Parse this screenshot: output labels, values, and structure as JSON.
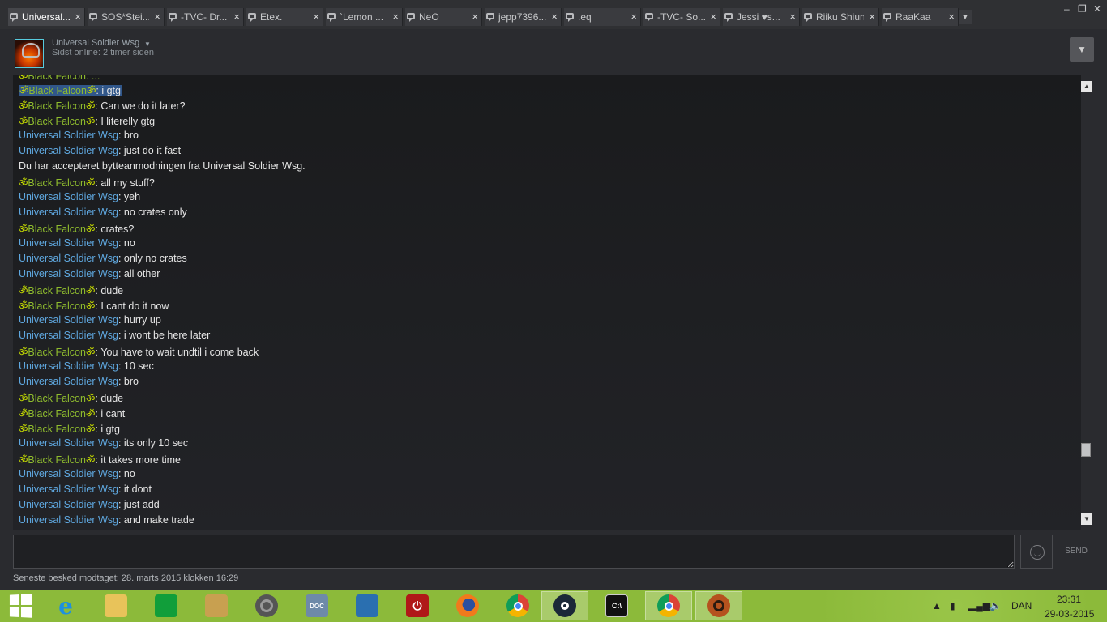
{
  "tabs": [
    {
      "label": "Universal...",
      "active": true
    },
    {
      "label": "SOS*Stei..."
    },
    {
      "label": "-TVC- Dr..."
    },
    {
      "label": "Etex."
    },
    {
      "label": "`Lemon ..."
    },
    {
      "label": "NeO"
    },
    {
      "label": "jepp7396..."
    },
    {
      "label": ".eq"
    },
    {
      "label": "-TVC- So..."
    },
    {
      "label": "Jessi ♥s..."
    },
    {
      "label": "Riiku Shiun"
    },
    {
      "label": "RaaKaa"
    }
  ],
  "window_controls": {
    "minimize": "–",
    "maximize": "❐",
    "close": "✕"
  },
  "header": {
    "friend_name": "Universal Soldier Wsg",
    "status": "Sidst online: 2 timer siden",
    "dropdown_icon": "▼"
  },
  "chat": {
    "om_symbol": "ॐ",
    "partial_top": "Black Falcon: ...",
    "messages": [
      {
        "who": "bf",
        "name": "Black Falcon",
        "text": "i gtg",
        "highlight": true
      },
      {
        "who": "bf",
        "name": "Black Falcon",
        "text": "Can we do it later?"
      },
      {
        "who": "bf",
        "name": "Black Falcon",
        "text": "I literelly gtg"
      },
      {
        "who": "us",
        "name": "Universal Soldier Wsg",
        "text": "bro"
      },
      {
        "who": "us",
        "name": "Universal Soldier Wsg",
        "text": "just do it fast"
      },
      {
        "who": "sys",
        "text": "Du har accepteret bytteanmodningen fra Universal Soldier Wsg."
      },
      {
        "who": "bf",
        "name": "Black Falcon",
        "text": "all my stuff?"
      },
      {
        "who": "us",
        "name": "Universal Soldier Wsg",
        "text": "yeh"
      },
      {
        "who": "us",
        "name": "Universal Soldier Wsg",
        "text": "no crates only"
      },
      {
        "who": "bf",
        "name": "Black Falcon",
        "text": "crates?"
      },
      {
        "who": "us",
        "name": "Universal Soldier Wsg",
        "text": "no"
      },
      {
        "who": "us",
        "name": "Universal Soldier Wsg",
        "text": "only no crates"
      },
      {
        "who": "us",
        "name": "Universal Soldier Wsg",
        "text": "all other"
      },
      {
        "who": "bf",
        "name": "Black Falcon",
        "text": "dude"
      },
      {
        "who": "bf",
        "name": "Black Falcon",
        "text": "I cant do it now"
      },
      {
        "who": "us",
        "name": "Universal Soldier Wsg",
        "text": "hurry up"
      },
      {
        "who": "us",
        "name": "Universal Soldier Wsg",
        "text": "i wont be here later"
      },
      {
        "who": "bf",
        "name": "Black Falcon",
        "text": "You have to wait undtil i come back"
      },
      {
        "who": "us",
        "name": "Universal Soldier Wsg",
        "text": "10 sec"
      },
      {
        "who": "us",
        "name": "Universal Soldier Wsg",
        "text": "bro"
      },
      {
        "who": "bf",
        "name": "Black Falcon",
        "text": "dude"
      },
      {
        "who": "bf",
        "name": "Black Falcon",
        "text": "i cant"
      },
      {
        "who": "bf",
        "name": "Black Falcon",
        "text": "i gtg"
      },
      {
        "who": "us",
        "name": "Universal Soldier Wsg",
        "text": "its only 10 sec"
      },
      {
        "who": "bf",
        "name": "Black Falcon",
        "text": "it takes more time"
      },
      {
        "who": "us",
        "name": "Universal Soldier Wsg",
        "text": "no"
      },
      {
        "who": "us",
        "name": "Universal Soldier Wsg",
        "text": "it dont"
      },
      {
        "who": "us",
        "name": "Universal Soldier Wsg",
        "text": "just add"
      },
      {
        "who": "us",
        "name": "Universal Soldier Wsg",
        "text": "and make trade"
      }
    ]
  },
  "input": {
    "value": "",
    "send_label": "SEND"
  },
  "footer": {
    "last_received": "Seneste besked modtaget: 28. marts 2015 klokken 16:29"
  },
  "taskbar": {
    "apps": [
      {
        "name": "start-button",
        "icon": "windows-logo-icon"
      },
      {
        "name": "internet-explorer",
        "icon": "internet-explorer-icon",
        "glyph": "e",
        "color": "#1e90e0"
      },
      {
        "name": "file-explorer",
        "icon": "folder-icon",
        "glyph": "",
        "color": "#e8c35a"
      },
      {
        "name": "store",
        "icon": "store-icon",
        "glyph": "",
        "color": "#119e3a"
      },
      {
        "name": "app-gear",
        "icon": "gear-app-icon",
        "glyph": "",
        "color": "#c8a050"
      },
      {
        "name": "media-player",
        "icon": "speaker-icon",
        "glyph": "",
        "color": "#555"
      },
      {
        "name": "doc-app",
        "icon": "document-icon",
        "glyph": "DOC",
        "color": "#6e8aa8"
      },
      {
        "name": "control-panel",
        "icon": "control-panel-icon",
        "glyph": "",
        "color": "#2a6fb0"
      },
      {
        "name": "shutdown-app",
        "icon": "power-icon",
        "glyph": "⏻",
        "color": "#b01818"
      },
      {
        "name": "firefox",
        "icon": "firefox-icon",
        "glyph": "",
        "color": "#e8661a"
      },
      {
        "name": "chrome",
        "icon": "chrome-icon",
        "glyph": "",
        "color": "#3a9a45"
      },
      {
        "name": "steam",
        "icon": "steam-icon",
        "glyph": "",
        "color": "#1b2838",
        "active": true
      },
      {
        "name": "cmd",
        "icon": "command-prompt-icon",
        "glyph": "C:\\",
        "color": "#111"
      },
      {
        "name": "chrome-2",
        "icon": "chrome-icon",
        "glyph": "",
        "color": "#3a9a45",
        "active": true
      },
      {
        "name": "tf2",
        "icon": "tf2-icon",
        "glyph": "",
        "color": "#b5521e",
        "active": true
      }
    ],
    "tray": {
      "language": "DAN",
      "time": "23:31",
      "date": "29-03-2015"
    }
  }
}
